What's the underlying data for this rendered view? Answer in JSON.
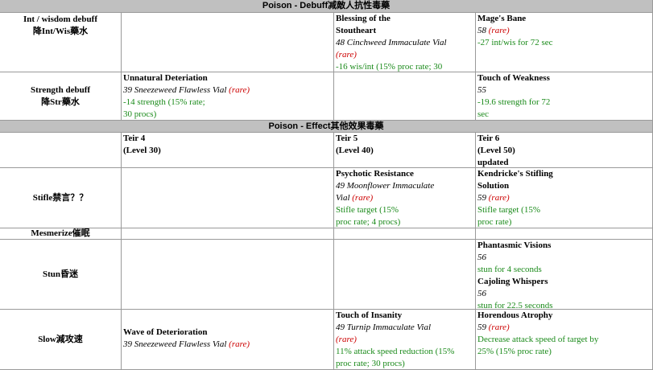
{
  "headers": {
    "debuff": "Poison - Debuff减敵人抗性毒藥",
    "effect": "Poison - Effect其他效果毒藥"
  },
  "rows": {
    "intwis": {
      "label1": "Int / wisdom debuff",
      "label2": "降Int/Wis藥水",
      "t5": {
        "name1": "Blessing of the",
        "name2": "Stoutheart",
        "src": "48 Cinchweed Immaculate Vial",
        "rare": "(rare)",
        "eff": "-16 wis/int (15% proc rate; 30"
      },
      "t6": {
        "name": "Mage's Bane",
        "src": "58",
        "rare": "(rare)",
        "eff": "-27 int/wis for 72 sec"
      }
    },
    "str": {
      "label1": "Strength debuff",
      "label2": "降Str藥水",
      "t4": {
        "name": "Unnatural Deteriation",
        "src": "39 Sneezeweed Flawless Vial",
        "rare": "(rare)",
        "eff1": "-14 strength (15% rate;",
        "eff2": "30 procs)"
      },
      "t6": {
        "name": "Touch of Weakness",
        "src": "55",
        "eff1": "-19.6 strength for 72",
        "eff2": "sec"
      }
    },
    "tiers": {
      "t4a": "Teir 4",
      "t4b": "(Level 30)",
      "t5a": "Teir 5",
      "t5b": "(Level 40)",
      "t6a": "Teir 6",
      "t6b": "(Level 50)",
      "t6c": "updated"
    },
    "stifle": {
      "label": "Stifle禁言？？",
      "t5": {
        "name": "Psychotic Resistance",
        "src1": "49 Moonflower Immaculate",
        "src2": "Vial",
        "rare": "(rare)",
        "eff1": "Stifle target (15%",
        "eff2": "proc rate; 4 procs)"
      },
      "t6": {
        "name1": "Kendricke's Stifling",
        "name2": "Solution",
        "src": "59",
        "rare": "(rare)",
        "eff1": "Stifle target (15%",
        "eff2": "proc rate)"
      }
    },
    "mesmerize": {
      "label": "Mesmerize催眠"
    },
    "stun": {
      "label": "Stun昏迷",
      "t6": {
        "name1": "Phantasmic Visions",
        "src1": "56",
        "eff1": "stun for 4 seconds",
        "name2": "Cajoling Whispers",
        "src2": "56",
        "eff2": "stun for 22.5 seconds"
      }
    },
    "slow": {
      "label": "Slow減攻速",
      "t4": {
        "name": "Wave of Deterioration",
        "src": "39 Sneezeweed Flawless Vial",
        "rare": "(rare)"
      },
      "t5": {
        "name": "Touch of Insanity",
        "src": "49 Turnip Immaculate Vial",
        "rare": "(rare)",
        "eff1": "11% attack speed reduction (15%",
        "eff2": "proc rate; 30 procs)"
      },
      "t6": {
        "name": "Horendous Atrophy",
        "src": "59",
        "rare": "(rare)",
        "eff1": "Decrease attack speed of target by",
        "eff2": "25% (15% proc rate)"
      }
    }
  }
}
